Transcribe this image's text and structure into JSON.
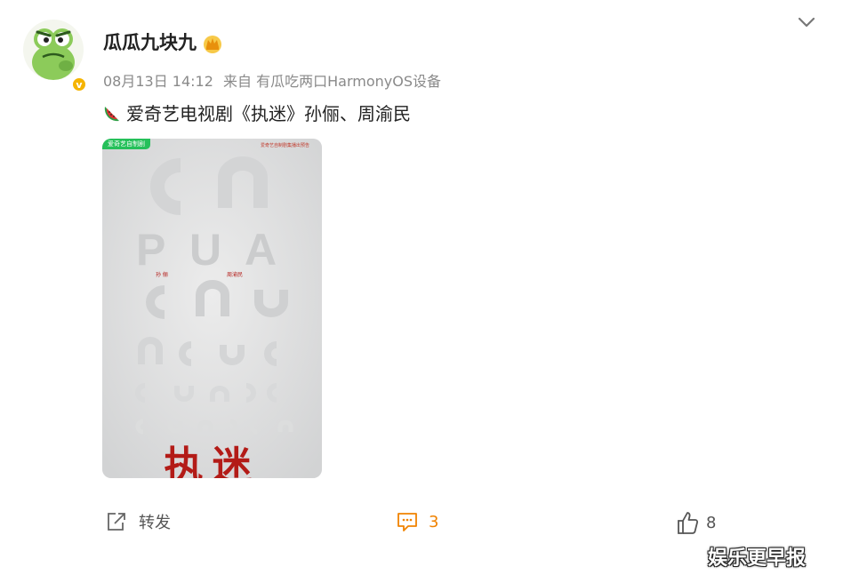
{
  "post": {
    "author": "瓜瓜九块九",
    "date": "08月13日 14:12",
    "source": "来自 有瓜吃两口HarmonyOS设备",
    "content": "爱奇艺电视剧《执迷》孙俪、周渝民",
    "emoji": "watermelon-icon",
    "image": {
      "tag": "爱奇艺自制剧",
      "top_note": "爱奇艺自制剧集播出预告",
      "chart_rows": [
        "PUA"
      ],
      "credits": [
        "孙 俪",
        "周渝民"
      ],
      "title": "执迷"
    }
  },
  "actions": {
    "forward_label": "转发",
    "comment_count": "3",
    "like_count": "8"
  },
  "watermark": "娱乐更早报",
  "colors": {
    "accent_orange": "#f08200",
    "verified_gold": "#f5b400",
    "iqiyi_green": "#25c05a",
    "title_red": "#b31b17"
  }
}
